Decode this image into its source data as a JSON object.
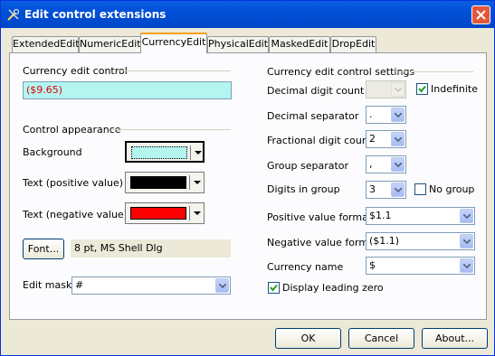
{
  "window": {
    "title": "Edit control extensions"
  },
  "tabs": [
    {
      "label": "ExtendedEdit"
    },
    {
      "label": "NumericEdit"
    },
    {
      "label": "CurrencyEdit"
    },
    {
      "label": "PhysicalEdit"
    },
    {
      "label": "MaskedEdit"
    },
    {
      "label": "DropEdit"
    }
  ],
  "currency_edit_control": {
    "group_label": "Currency edit control",
    "value": "($9.65)"
  },
  "appearance": {
    "group_label": "Control appearance",
    "background_label": "Background",
    "text_positive_label": "Text (positive value)",
    "text_negative_label": "Text (negative value)",
    "background_color": "#b4f5f0",
    "positive_color": "#000000",
    "negative_color": "#ff0000",
    "font_button": "Font...",
    "font_value": "8 pt, MS Shell Dlg",
    "edit_mask_label": "Edit mask",
    "edit_mask_value": "#"
  },
  "settings": {
    "group_label": "Currency edit control settings",
    "decimal_digit_count_label": "Decimal digit count",
    "decimal_digit_count_value": "",
    "indefinite_label": "Indefinite",
    "indefinite_checked": true,
    "decimal_separator_label": "Decimal separator",
    "decimal_separator_value": ".",
    "fractional_digit_count_label": "Fractional digit count",
    "fractional_digit_count_value": "2",
    "group_separator_label": "Group separator",
    "group_separator_value": ",",
    "digits_in_group_label": "Digits in group",
    "digits_in_group_value": "3",
    "no_group_label": "No group",
    "no_group_checked": false,
    "positive_format_label": "Positive value format",
    "positive_format_value": "$1.1",
    "negative_format_label": "Negative value format",
    "negative_format_value": "($1.1)",
    "currency_name_label": "Currency name",
    "currency_name_value": "$",
    "display_leading_zero_label": "Display leading zero",
    "display_leading_zero_checked": true
  },
  "buttons": {
    "ok": "OK",
    "cancel": "Cancel",
    "about": "About..."
  }
}
